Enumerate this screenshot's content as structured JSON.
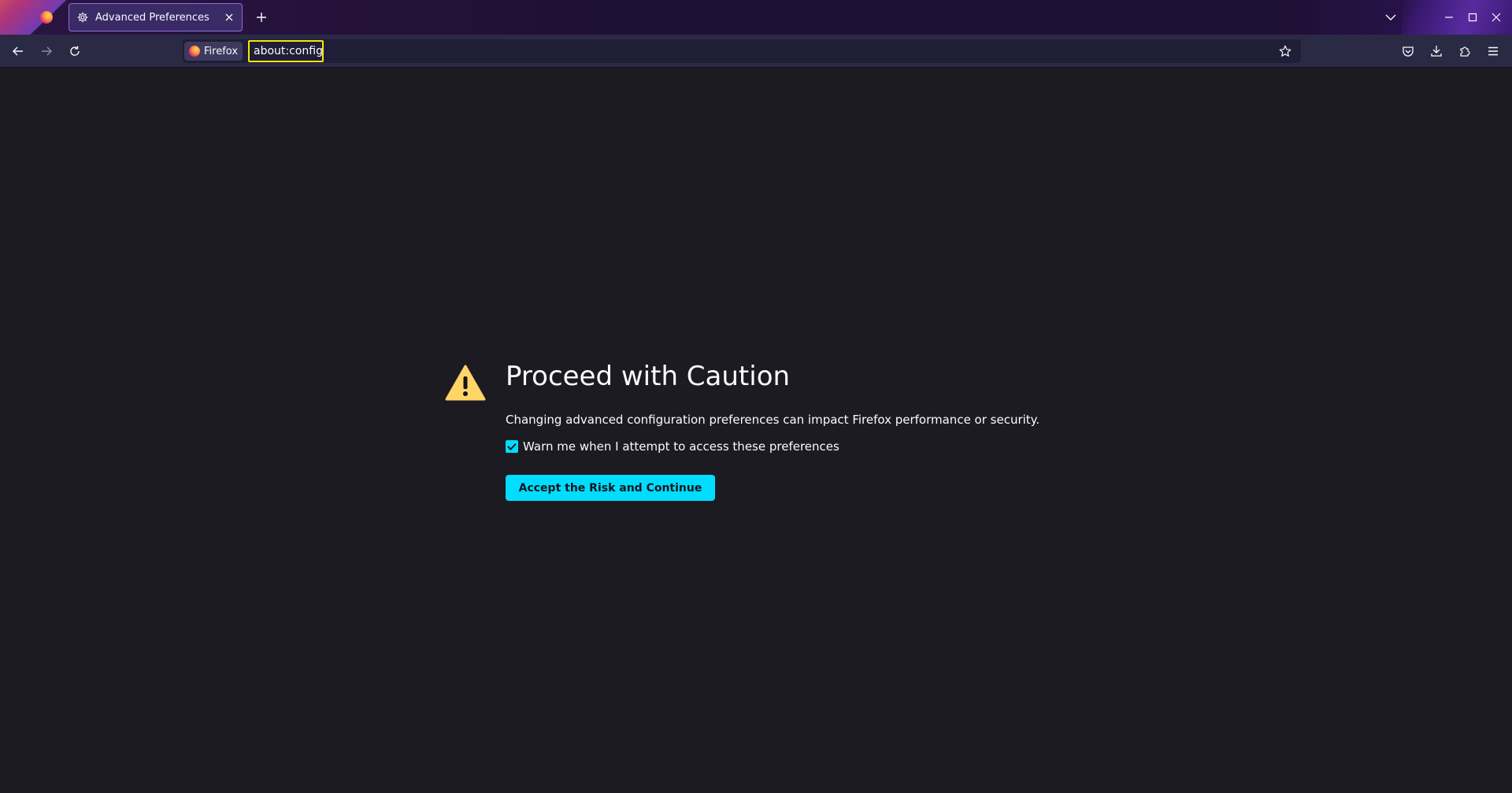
{
  "browser": {
    "name": "Firefox",
    "accent_color": "#00ddff",
    "highlight_color": "#f5e60c"
  },
  "tabs": [
    {
      "title": "Advanced Preferences",
      "icon": "gear-icon",
      "active": true
    }
  ],
  "urlbar": {
    "identity_label": "Firefox",
    "value": "about:config"
  },
  "content": {
    "title": "Proceed with Caution",
    "description": "Changing advanced configuration preferences can impact Firefox performance or security.",
    "warn_checkbox": {
      "label": "Warn me when I attempt to access these preferences",
      "checked": true
    },
    "accept_button": "Accept the Risk and Continue",
    "warning_color": "#ffd567"
  }
}
